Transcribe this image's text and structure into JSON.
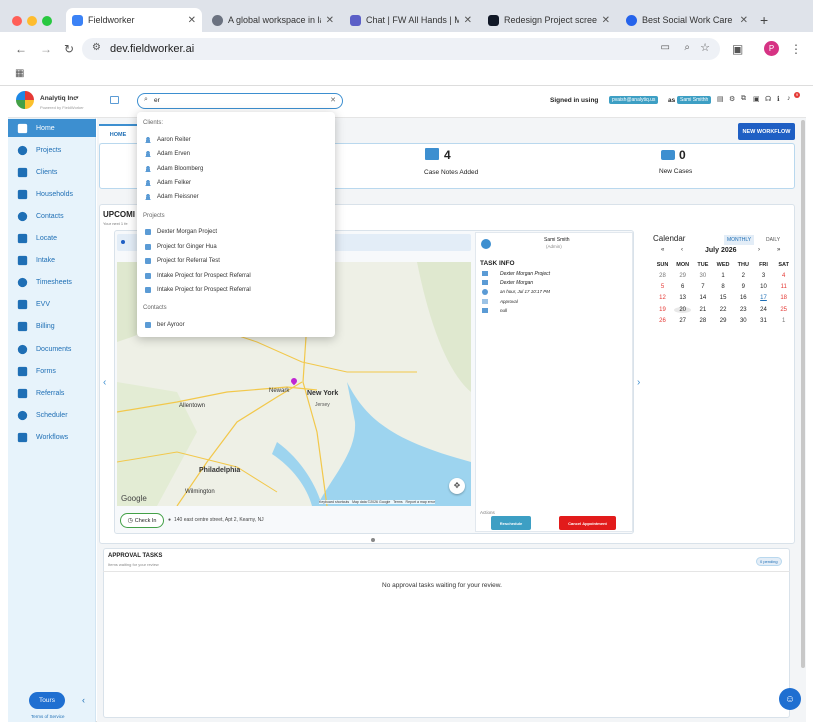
{
  "browser": {
    "tabs": [
      {
        "title": "Fieldworker",
        "color": "#3b82f6"
      },
      {
        "title": "A global workspace in la",
        "color": "#6b7280"
      },
      {
        "title": "Chat | FW All Hands | Mi",
        "color": "#5b5fc7"
      },
      {
        "title": "Redesign Project screen",
        "color": "#111827"
      },
      {
        "title": "Best Social Work Care M",
        "color": "#2563eb"
      }
    ],
    "new_tab": "+",
    "url": "dev.fieldworker.ai",
    "profile_initial": "P"
  },
  "header": {
    "org_name": "Analytiq Inc",
    "org_caret": "▾",
    "powered_by": "Powered by FieldWorker",
    "search_value": "er",
    "signed_in_text": "Signed in using",
    "signed_in_email": "pvaish@analytiq.us",
    "as_text": "as",
    "user_name": "Sami Smithh",
    "notification_count": "9"
  },
  "sidebar": {
    "items": [
      {
        "label": "Home",
        "icon": "home-icon"
      },
      {
        "label": "Projects",
        "icon": "projects-icon"
      },
      {
        "label": "Clients",
        "icon": "clients-icon"
      },
      {
        "label": "Households",
        "icon": "households-icon"
      },
      {
        "label": "Contacts",
        "icon": "contacts-icon"
      },
      {
        "label": "Locate",
        "icon": "locate-icon"
      },
      {
        "label": "Intake",
        "icon": "intake-icon"
      },
      {
        "label": "Timesheets",
        "icon": "timesheets-icon"
      },
      {
        "label": "EVV",
        "icon": "evv-icon"
      },
      {
        "label": "Billing",
        "icon": "billing-icon"
      },
      {
        "label": "Documents",
        "icon": "documents-icon"
      },
      {
        "label": "Forms",
        "icon": "forms-icon"
      },
      {
        "label": "Referrals",
        "icon": "referrals-icon"
      },
      {
        "label": "Scheduler",
        "icon": "scheduler-icon"
      },
      {
        "label": "Workflows",
        "icon": "workflows-icon"
      }
    ],
    "tours_label": "Tours",
    "terms_label": "Terms of Service"
  },
  "main": {
    "home_tab": "HOME",
    "new_workflow_label": "NEW WORKFLOW",
    "stats": [
      {
        "value": "4",
        "label": "Case Notes Added"
      },
      {
        "value": "0",
        "label": "New Cases"
      }
    ],
    "upcoming_title": "UPCOMI",
    "upcoming_sub": "Your next 1 fe",
    "task": {
      "assignee_name": "Sami Smith",
      "assignee_role": "(Admin)",
      "section_title": "TASK INFO",
      "project": "Dexter Morgan Project",
      "client": "Dexter Morgan",
      "time": "an hour, Jul 17 10:17 PM",
      "type": "Approval",
      "note": "null",
      "actions_label": "Actions",
      "reschedule_label": "Reschedule",
      "cancel_label": "Cancel Appointment"
    },
    "checkin_label": "Check In",
    "address": "140 east centre street, Apt 2, Kearny, NJ",
    "approval": {
      "title": "APPROVAL TASKS",
      "sub": "Items waiting for your review",
      "badge": "0 pending",
      "empty": "No approval tasks waiting for your review."
    }
  },
  "map": {
    "google": "Google",
    "attribution": "Keyboard shortcuts   Map data ©2026 Google   Terms   Report a map error",
    "labels": [
      {
        "text": "New York"
      },
      {
        "text": "Newark"
      },
      {
        "text": "Allentown"
      },
      {
        "text": "Philadelphia"
      },
      {
        "text": "Wilmington"
      },
      {
        "text": "Jersey"
      }
    ]
  },
  "dropdown": {
    "clients_heading": "Clients:",
    "clients": [
      "Aaron Reiter",
      "Adam Erven",
      "Adam Bloomberg",
      "Adam Felker",
      "Adam Fleissner"
    ],
    "projects_heading": "Projects",
    "projects": [
      "Dexter Morgan Project",
      "Project for Ginger Hua",
      "Project for Referral Test",
      "Intake Project for Prospect Referral",
      "Intake Project for Prospect Referral"
    ],
    "contacts_heading": "Contacts",
    "contacts": [
      "ber Ayroor"
    ]
  },
  "calendar": {
    "title": "Calendar",
    "monthly": "MONTHLY",
    "daily": "DAILY",
    "month_label": "July 2026",
    "nav": [
      "«",
      "‹",
      "›",
      "»"
    ],
    "weekdays": [
      "SUN",
      "MON",
      "TUE",
      "WED",
      "THU",
      "FRI",
      "SAT"
    ],
    "weeks": [
      [
        "28",
        "29",
        "30",
        "1",
        "2",
        "3",
        "4"
      ],
      [
        "5",
        "6",
        "7",
        "8",
        "9",
        "10",
        "11"
      ],
      [
        "12",
        "13",
        "14",
        "15",
        "16",
        "17",
        "18"
      ],
      [
        "19",
        "20",
        "21",
        "22",
        "23",
        "24",
        "25"
      ],
      [
        "26",
        "27",
        "28",
        "29",
        "30",
        "31",
        "1"
      ]
    ]
  }
}
